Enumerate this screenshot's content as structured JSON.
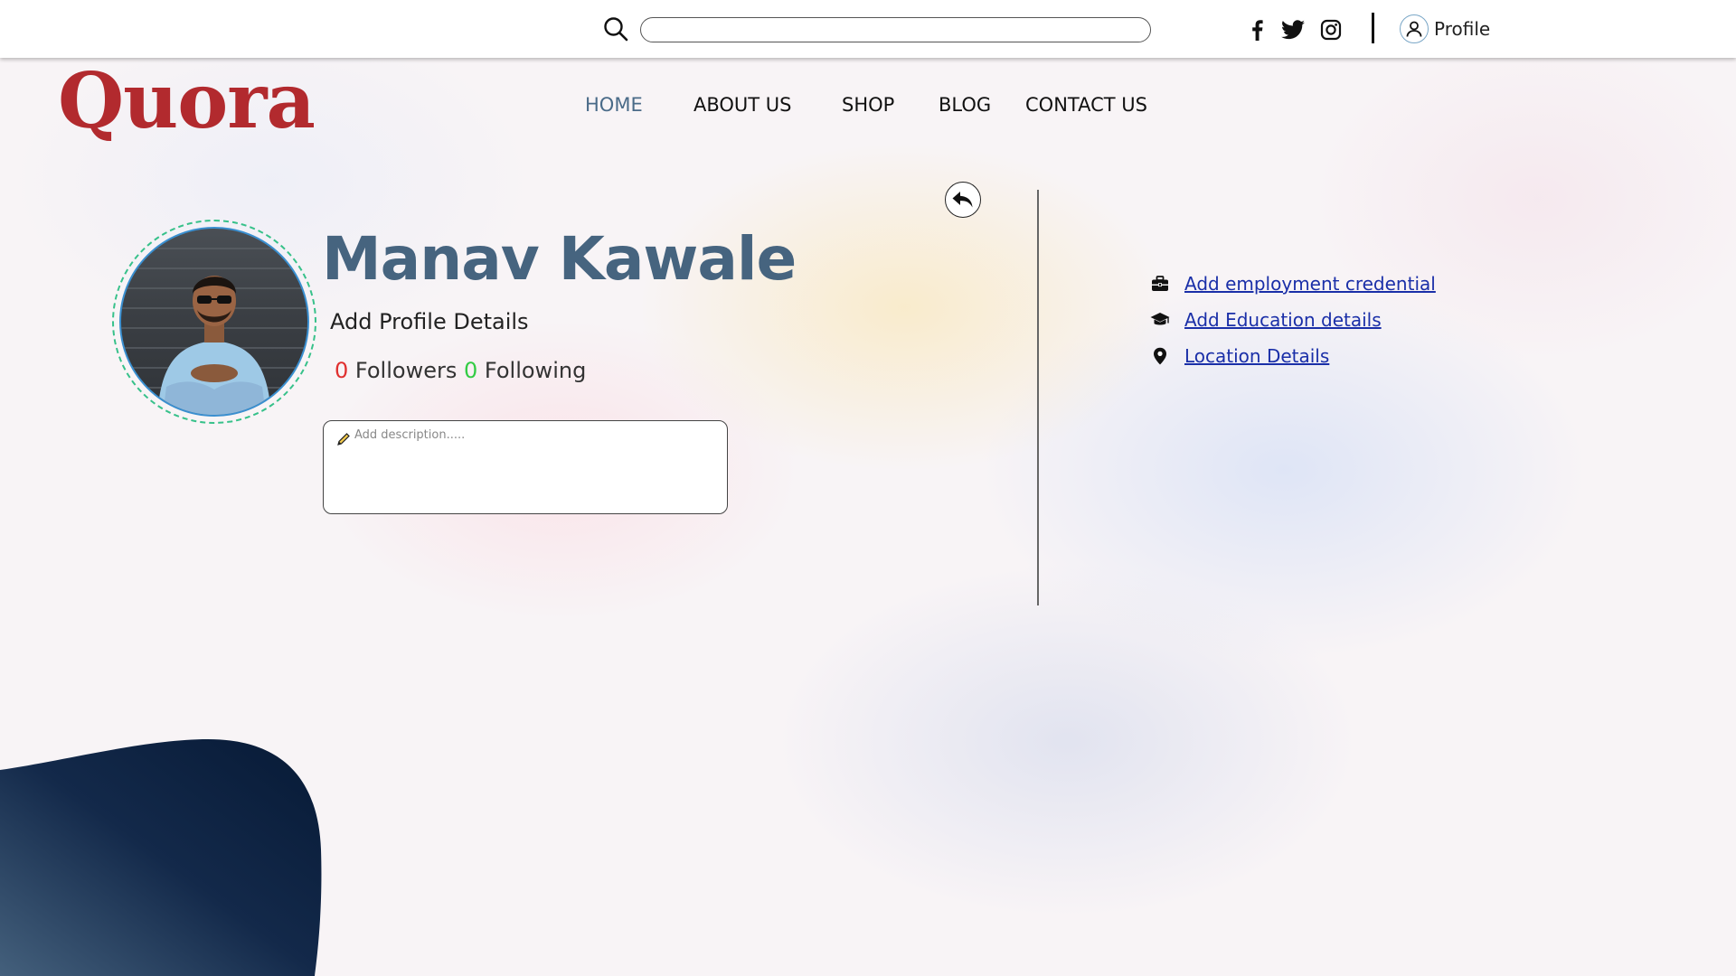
{
  "topbar": {
    "search": {
      "placeholder": "",
      "value": ""
    },
    "profile_label": "Profile",
    "social_icons": [
      "facebook-icon",
      "twitter-icon",
      "instagram-icon"
    ]
  },
  "logo": {
    "text": "Quora"
  },
  "nav": {
    "items": [
      {
        "label": "HOME",
        "active": true
      },
      {
        "label": "ABOUT US",
        "active": false
      },
      {
        "label": "SHOP",
        "active": false
      },
      {
        "label": "BLOG",
        "active": false
      },
      {
        "label": "CONTACT US",
        "active": false
      }
    ]
  },
  "profile": {
    "name": "Manav Kawale",
    "add_details_label": "Add Profile Details",
    "followers_count": "0",
    "followers_label": "Followers",
    "following_count": "0",
    "following_label": "Following",
    "description_placeholder": "Add description.....",
    "description_value": ""
  },
  "credentials": {
    "items": [
      {
        "label": "Add employment credential",
        "icon": "briefcase-icon"
      },
      {
        "label": "Add Education details",
        "icon": "graduation-cap-icon"
      },
      {
        "label": "Location Details",
        "icon": "map-pin-icon"
      }
    ]
  },
  "colors": {
    "brand": "#b22a2e",
    "nav_active": "#4a6b88",
    "name": "#46647f",
    "followers_count": "#e0302f",
    "following_count": "#33cc44",
    "link": "#1a2fa8",
    "blob": "#0d2240"
  }
}
